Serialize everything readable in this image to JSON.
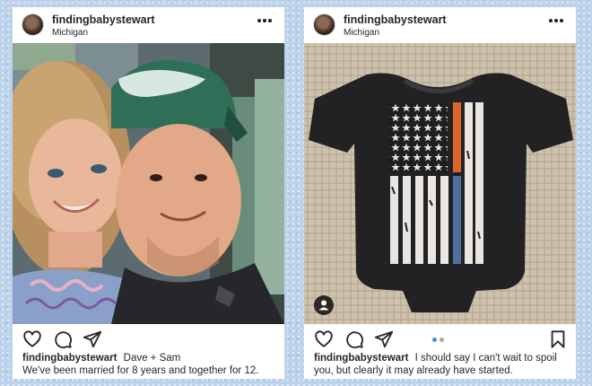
{
  "posts": [
    {
      "username": "findingbabystewart",
      "location": "Michigan",
      "caption_user": "findingbabystewart",
      "caption_text": "Dave + Sam",
      "caption_text_2": "We've been married for 8 years and together for 12."
    },
    {
      "username": "findingbabystewart",
      "location": "Michigan",
      "caption_user": "findingbabystewart",
      "caption_text": "I should say I can't wait to spoil you, but clearly it may already have started.",
      "carousel": {
        "current": 1,
        "total": 2
      }
    }
  ],
  "icons": {
    "more": "more-options-icon",
    "like": "heart-icon",
    "comment": "comment-icon",
    "share": "paper-plane-icon",
    "save": "bookmark-icon",
    "tag": "user-tag-icon"
  },
  "colors": {
    "background": "#bcd3ea",
    "card": "#ffffff",
    "text": "#262626",
    "carousel_active": "#3897f0",
    "carousel_inactive": "#a8a8a8",
    "flag_red_line": "#d9652a",
    "flag_blue_line": "#4f6fa0"
  }
}
